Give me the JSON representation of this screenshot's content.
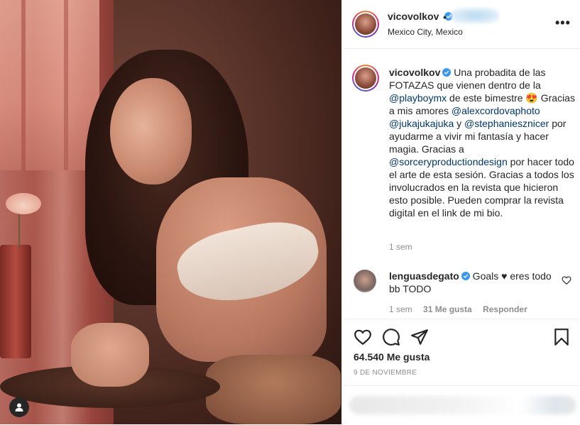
{
  "post": {
    "username": "vicovolkov",
    "location": "Mexico City, Mexico",
    "more_label": "•••",
    "dot": "•"
  },
  "caption": {
    "username": "vicovolkov",
    "segments": [
      {
        "type": "text",
        "text": " Una probadita de las FOTAZAS que vienen dentro de la "
      },
      {
        "type": "mention",
        "text": "@playboymx"
      },
      {
        "type": "text",
        "text": " de este bimestre 😍 Gracias a mis amores "
      },
      {
        "type": "mention",
        "text": "@alexcordovaphoto"
      },
      {
        "type": "text",
        "text": " "
      },
      {
        "type": "mention",
        "text": "@jukajukajuka"
      },
      {
        "type": "text",
        "text": " y "
      },
      {
        "type": "mention",
        "text": "@stephaniesznicer"
      },
      {
        "type": "text",
        "text": " por ayudarme a vivir mi fantasía y hacer magia. Gracias a "
      },
      {
        "type": "mention",
        "text": "@sorceryproductiondesign"
      },
      {
        "type": "text",
        "text": " por hacer todo el arte de esta sesión. Gracias a todos los involucrados en la revista que hicieron esto posible. Pueden comprar la revista digital en el link de mi bio."
      }
    ],
    "time": "1 sem"
  },
  "comment": {
    "username": "lenguasdegato",
    "text": " Goals ♥ eres todo bb TODO",
    "time": "1 sem",
    "likes": "31 Me gusta",
    "reply": "Responder"
  },
  "stats": {
    "likes": "64.540 Me gusta",
    "date": "9 DE NOVIEMBRE"
  },
  "icons": {
    "like": "heart-icon",
    "comment": "comment-icon",
    "share": "share-icon",
    "save": "bookmark-icon",
    "more": "more-options-icon",
    "verified": "verified-badge-icon",
    "user_tag": "user-tag-icon"
  },
  "colors": {
    "mention": "#00376b",
    "verified": "#3897f0",
    "muted": "#8e8e8e",
    "text": "#262626"
  }
}
